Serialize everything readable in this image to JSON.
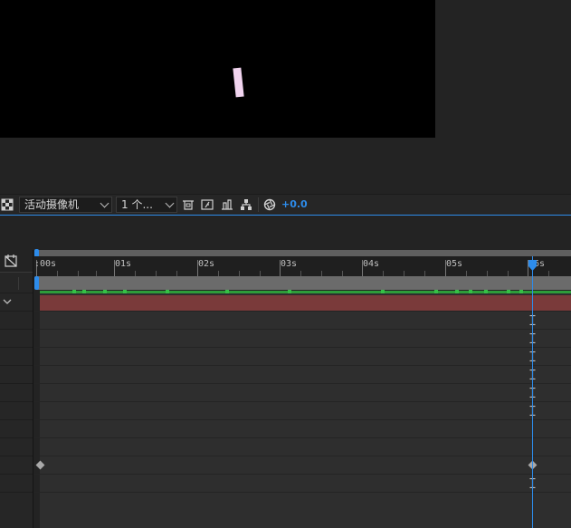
{
  "viewer": {
    "background": "#000000",
    "shape_color": "#f1d4ef"
  },
  "toolbar": {
    "transparency_grid_icon": "checker-icon",
    "camera_view": {
      "selected": "活动摄像机"
    },
    "views_layout": {
      "selected": "1 个..."
    },
    "toggle_icons": [
      "region-of-interest-icon",
      "snapshot-icon",
      "show-snapshot-icon",
      "flowchart-icon",
      "reset-exposure-icon"
    ],
    "exposure": "+0.0",
    "accent_color": "#2d8ceb"
  },
  "timeline": {
    "comp_icon": "comp-marker-icon",
    "ruler_labels": [
      ":00s",
      "01s",
      "02s",
      "03s",
      "04s",
      "05s",
      "06s"
    ],
    "layer_bar_color": "#7a3a3a",
    "cache_color": "#2e9c3a",
    "playhead_color": "#2d8ceb",
    "current_time_label": "06s"
  }
}
